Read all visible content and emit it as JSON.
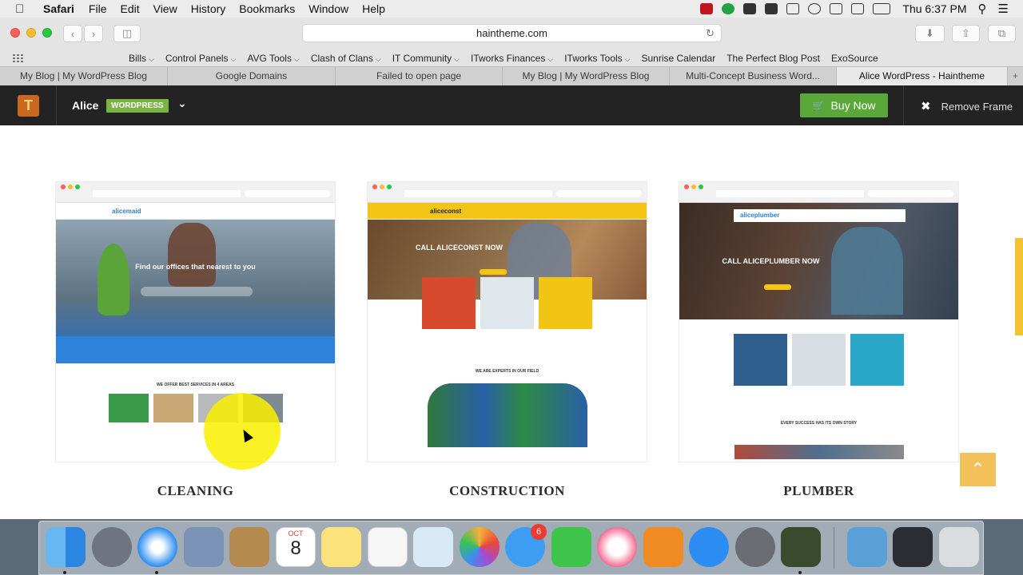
{
  "menubar": {
    "app": "Safari",
    "items": [
      "File",
      "Edit",
      "View",
      "History",
      "Bookmarks",
      "Window",
      "Help"
    ],
    "clock": "Thu 6:37 PM"
  },
  "toolbar": {
    "url": "haintheme.com"
  },
  "bookmarks": [
    {
      "label": "Bills",
      "has_menu": true
    },
    {
      "label": "Control Panels",
      "has_menu": true
    },
    {
      "label": "AVG Tools",
      "has_menu": true
    },
    {
      "label": "Clash of Clans",
      "has_menu": true
    },
    {
      "label": "IT Community",
      "has_menu": true
    },
    {
      "label": "ITworks Finances",
      "has_menu": true
    },
    {
      "label": "ITworks Tools",
      "has_menu": true
    },
    {
      "label": "Sunrise Calendar",
      "has_menu": false
    },
    {
      "label": "The Perfect Blog Post",
      "has_menu": false
    },
    {
      "label": "ExoSource",
      "has_menu": false
    }
  ],
  "tabs": [
    {
      "label": "My Blog | My WordPress Blog",
      "active": false
    },
    {
      "label": "Google Domains",
      "active": false
    },
    {
      "label": "Failed to open page",
      "active": false
    },
    {
      "label": "My Blog | My WordPress Blog",
      "active": false
    },
    {
      "label": "Multi-Concept Business Word...",
      "active": false
    },
    {
      "label": "Alice WordPress - Haintheme",
      "active": true
    }
  ],
  "framebar": {
    "theme_name": "Alice",
    "badge": "WORDPRESS",
    "buy_label": "Buy Now",
    "remove_label": "Remove Frame"
  },
  "cards": [
    {
      "label": "CLEANING",
      "logo": "alicemaid",
      "hero_title": "Find our offices that nearest to you",
      "section_title": "WE OFFER BEST SERVICES IN 4 AREAS"
    },
    {
      "label": "CONSTRUCTION",
      "logo": "aliceconst",
      "hero_title": "CALL ALICECONST NOW",
      "section_title": "WE ARE EXPERTS IN OUR FIELD"
    },
    {
      "label": "PLUMBER",
      "logo": "aliceplumber",
      "hero_title": "CALL ALICEPLUMBER NOW",
      "section_title": "EVERY SUCCESS HAS ITS OWN STORY"
    }
  ],
  "dock": {
    "messages_badge": "6",
    "calendar_month": "OCT",
    "calendar_day": "8"
  }
}
